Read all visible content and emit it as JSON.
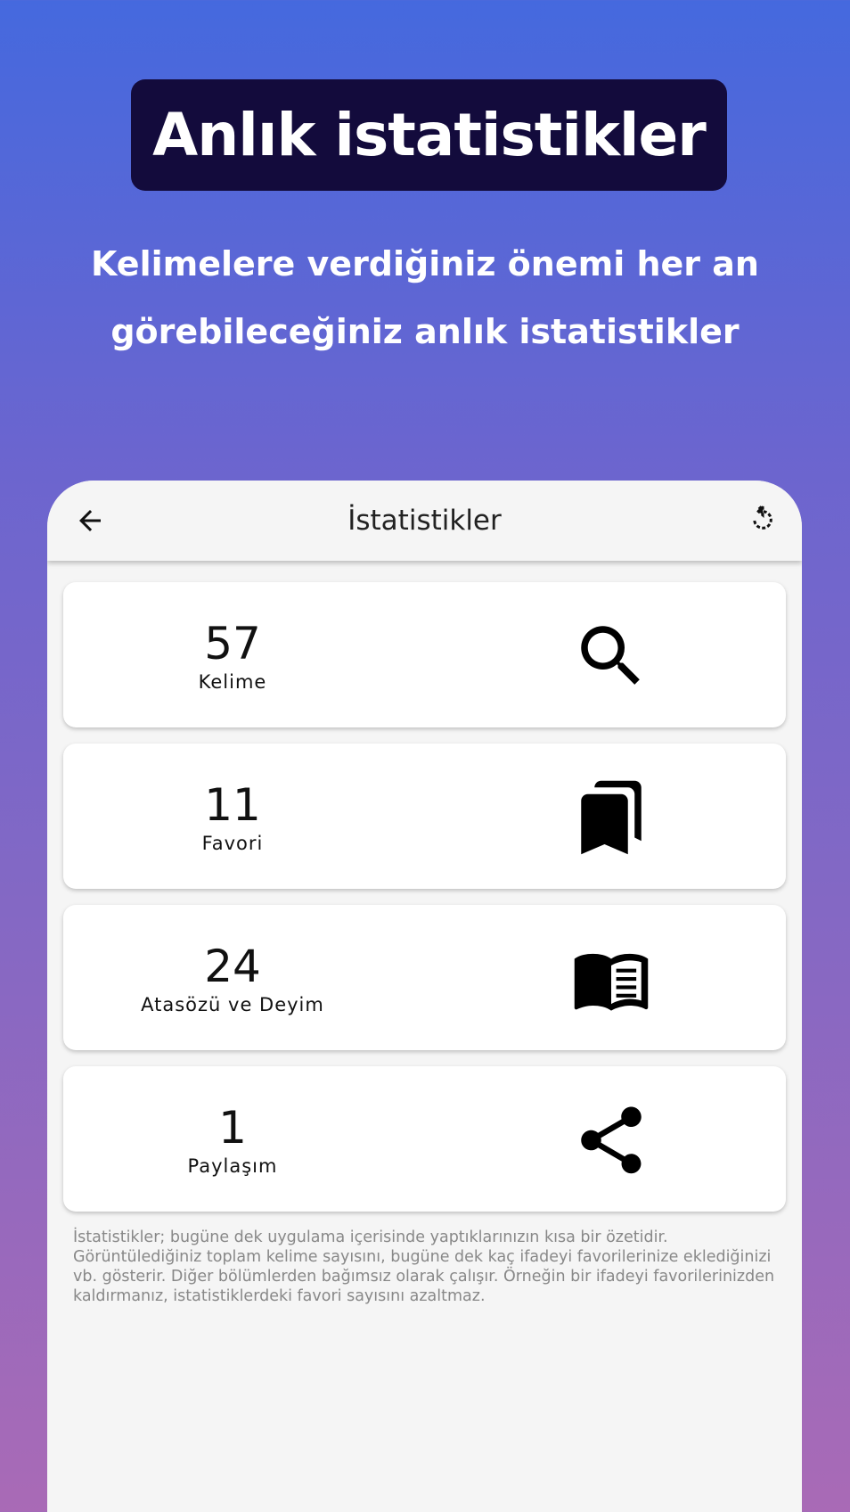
{
  "promo": {
    "title": "Anlık istatistikler",
    "subtitle_line1": "Kelimelere verdiğiniz önemi her an",
    "subtitle_line2": "görebileceğiniz anlık istatistikler"
  },
  "appbar": {
    "title": "İstatistikler",
    "back_icon": "arrow-back-icon",
    "reset_icon": "restart-icon"
  },
  "stats": [
    {
      "value": "57",
      "label": "Kelime",
      "icon": "search-icon"
    },
    {
      "value": "11",
      "label": "Favori",
      "icon": "bookmarks-icon"
    },
    {
      "value": "24",
      "label": "Atasözü ve Deyim",
      "icon": "open-book-icon"
    },
    {
      "value": "1",
      "label": "Paylaşım",
      "icon": "share-icon"
    }
  ],
  "info_text": "İstatistikler; bugüne dek uygulama içerisinde yaptıklarınızın kısa bir özetidir. Görüntülediğiniz toplam kelime sayısını, bugüne dek kaç ifadeyi favorilerinize eklediğinizi vb. gösterir. Diğer bölümlerden bağımsız olarak çalışır. Örneğin bir ifadeyi favorilerinizden kaldırmanız, istatistiklerdeki favori sayısını azaltmaz."
}
